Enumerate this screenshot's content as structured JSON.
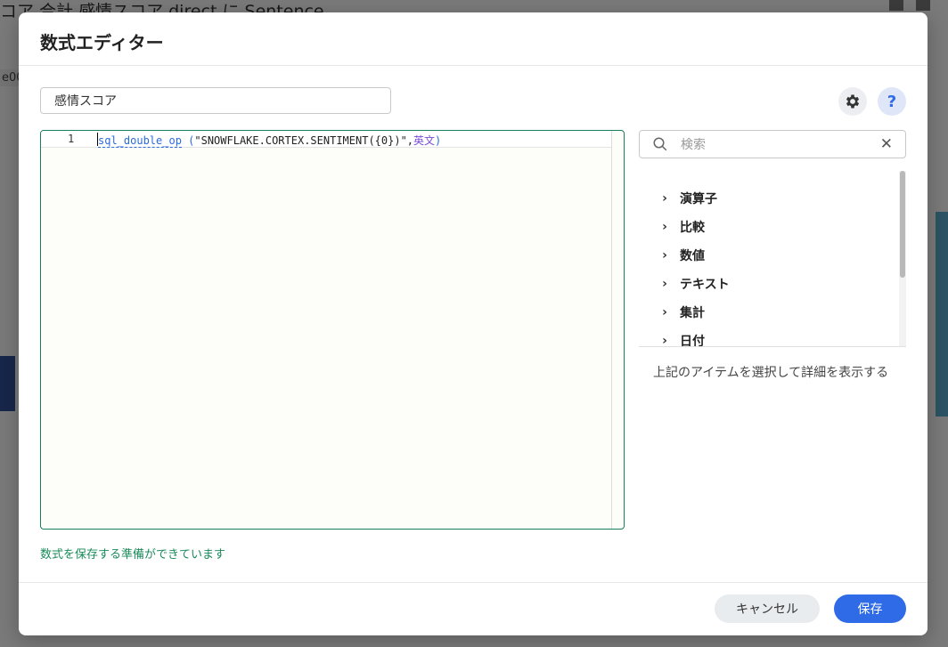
{
  "background": {
    "title": "コア  合計 感情スコア  direct に Sentence",
    "left_label": "e00"
  },
  "modal": {
    "title": "数式エディター",
    "field_name_value": "感情スコア",
    "help_label": "?"
  },
  "editor": {
    "line_number": "1",
    "code": {
      "function": "sql_double_op",
      "open_paren": " (",
      "string_arg": "\"SNOWFLAKE.CORTEX.SENTIMENT({0})\",",
      "field_arg": "英文",
      "close_paren": ")"
    },
    "status": "数式を保存する準備ができています"
  },
  "search": {
    "placeholder": "検索",
    "value": ""
  },
  "categories": [
    {
      "label": "演算子"
    },
    {
      "label": "比較"
    },
    {
      "label": "数値"
    },
    {
      "label": "テキスト"
    },
    {
      "label": "集計"
    },
    {
      "label": "日付"
    }
  ],
  "detail_hint": "上記のアイテムを選択して詳細を表示する",
  "footer": {
    "cancel_label": "キャンセル",
    "save_label": "保存"
  },
  "colors": {
    "primary": "#2f6be6",
    "editor_border": "#1a7f5a",
    "status_text": "#1a8a5a"
  }
}
